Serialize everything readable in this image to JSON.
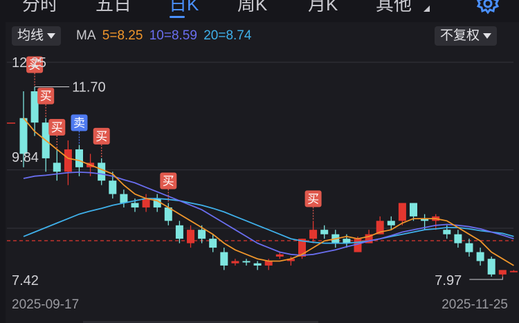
{
  "tabs": [
    {
      "label": "分时",
      "active": false
    },
    {
      "label": "五日",
      "active": false
    },
    {
      "label": "日K",
      "active": true
    },
    {
      "label": "周K",
      "active": false
    },
    {
      "label": "月K",
      "active": false
    },
    {
      "label": "其他",
      "active": false
    }
  ],
  "toolbar": {
    "ma_type": "均线",
    "adjust": "不复权",
    "settings_icon": "gear-icon"
  },
  "ma_legend": {
    "prefix": "MA",
    "ma5": "5=8.25",
    "ma10": "10=8.59",
    "ma20": "20=8.74"
  },
  "colors": {
    "up": "#e2362f",
    "down": "#7ee6e0",
    "ma5": "#f0962b",
    "ma10": "#6a6ef0",
    "ma20": "#3fb0ea",
    "accent": "#4a90ff",
    "buy": "#e0594d",
    "sell": "#4e7af0"
  },
  "chart_data": {
    "type": "candlestick",
    "y_range": [
      7.42,
      12.25
    ],
    "y_labels": [
      "12.25",
      "9.84",
      "7.42"
    ],
    "max_label": "11.70",
    "min_label": "7.97",
    "last_close": 7.97,
    "dates": {
      "start": "2025-09-17",
      "end": "2025-11-25"
    },
    "candles": [
      [
        11.0,
        10.2,
        11.6,
        9.9
      ],
      [
        11.6,
        10.9,
        11.7,
        10.6
      ],
      [
        10.9,
        10.1,
        11.0,
        9.8
      ],
      [
        10.0,
        9.8,
        10.3,
        9.6
      ],
      [
        9.8,
        10.3,
        10.5,
        9.5
      ],
      [
        10.3,
        9.9,
        10.4,
        9.7
      ],
      [
        9.9,
        10.0,
        10.2,
        9.7
      ],
      [
        10.0,
        9.6,
        10.1,
        9.5
      ],
      [
        9.6,
        9.3,
        9.8,
        9.2
      ],
      [
        9.3,
        9.1,
        9.4,
        9.0
      ],
      [
        9.1,
        9.0,
        9.2,
        8.9
      ],
      [
        9.0,
        9.2,
        9.3,
        8.9
      ],
      [
        9.2,
        9.0,
        9.3,
        8.9
      ],
      [
        9.0,
        8.7,
        9.1,
        8.6
      ],
      [
        8.6,
        8.3,
        8.7,
        8.2
      ],
      [
        8.2,
        8.5,
        8.6,
        8.1
      ],
      [
        8.5,
        8.3,
        8.6,
        8.2
      ],
      [
        8.3,
        8.1,
        8.4,
        8.0
      ],
      [
        8.0,
        7.7,
        8.1,
        7.6
      ],
      [
        7.75,
        7.8,
        7.85,
        7.7
      ],
      [
        7.8,
        7.78,
        7.85,
        7.7
      ],
      [
        7.75,
        7.7,
        7.8,
        7.6
      ],
      [
        7.7,
        7.8,
        7.85,
        7.6
      ],
      [
        7.9,
        7.95,
        8.0,
        7.85
      ],
      [
        7.8,
        7.85,
        7.9,
        7.7
      ],
      [
        7.9,
        8.3,
        8.3,
        7.85
      ],
      [
        8.3,
        8.5,
        8.7,
        8.2
      ],
      [
        8.5,
        8.4,
        8.6,
        8.3
      ],
      [
        8.4,
        8.2,
        8.5,
        8.1
      ],
      [
        8.3,
        8.2,
        8.4,
        8.1
      ],
      [
        8.0,
        8.3,
        8.35,
        8.0
      ],
      [
        8.2,
        8.4,
        8.5,
        8.2
      ],
      [
        8.4,
        8.7,
        8.8,
        8.4
      ],
      [
        8.7,
        8.6,
        8.8,
        8.5
      ],
      [
        8.7,
        9.1,
        9.1,
        8.6
      ],
      [
        9.1,
        8.8,
        9.1,
        8.7
      ],
      [
        8.75,
        8.7,
        8.85,
        8.5
      ],
      [
        8.7,
        8.8,
        8.85,
        8.5
      ],
      [
        8.5,
        8.4,
        8.6,
        8.3
      ],
      [
        8.4,
        8.2,
        8.5,
        8.1
      ],
      [
        8.2,
        8.0,
        8.3,
        7.9
      ],
      [
        8.0,
        7.8,
        8.1,
        7.7
      ],
      [
        7.85,
        7.5,
        7.9,
        7.45
      ],
      [
        7.5,
        7.6,
        7.55,
        7.45
      ],
      [
        7.58,
        7.58,
        7.6,
        7.55
      ]
    ],
    "ma5": [
      11.0,
      10.7,
      10.5,
      10.3,
      10.1,
      10.05,
      9.95,
      9.85,
      9.75,
      9.5,
      9.3,
      9.2,
      9.15,
      9.0,
      8.85,
      8.7,
      8.55,
      8.4,
      8.2,
      8.05,
      7.95,
      7.85,
      7.8,
      7.8,
      7.85,
      7.95,
      8.1,
      8.25,
      8.3,
      8.35,
      8.3,
      8.35,
      8.45,
      8.5,
      8.65,
      8.75,
      8.75,
      8.75,
      8.7,
      8.55,
      8.4,
      8.25,
      8.0,
      7.85,
      7.7
    ],
    "ma10": [
      9.65,
      9.7,
      9.72,
      9.75,
      9.78,
      9.79,
      9.78,
      9.75,
      9.7,
      9.62,
      9.55,
      9.45,
      9.35,
      9.25,
      9.15,
      9.05,
      8.95,
      8.8,
      8.65,
      8.5,
      8.35,
      8.2,
      8.1,
      8.0,
      7.95,
      7.93,
      7.95,
      8.0,
      8.05,
      8.12,
      8.18,
      8.25,
      8.3,
      8.37,
      8.45,
      8.5,
      8.55,
      8.6,
      8.62,
      8.6,
      8.57,
      8.52,
      8.45,
      8.38,
      8.3
    ],
    "ma20": [
      8.35,
      8.45,
      8.55,
      8.65,
      8.75,
      8.85,
      8.92,
      8.98,
      9.05,
      9.1,
      9.15,
      9.2,
      9.2,
      9.18,
      9.15,
      9.1,
      9.05,
      8.98,
      8.9,
      8.8,
      8.7,
      8.6,
      8.5,
      8.4,
      8.3,
      8.25,
      8.22,
      8.2,
      8.2,
      8.2,
      8.22,
      8.25,
      8.3,
      8.35,
      8.4,
      8.45,
      8.5,
      8.52,
      8.55,
      8.55,
      8.52,
      8.48,
      8.45,
      8.42,
      8.35
    ],
    "signals": [
      {
        "label": "买",
        "index": 1,
        "type": "buy"
      },
      {
        "label": "买",
        "index": 2,
        "type": "buy"
      },
      {
        "label": "买",
        "index": 3,
        "type": "buy"
      },
      {
        "label": "卖",
        "index": 5,
        "type": "sell"
      },
      {
        "label": "买",
        "index": 7,
        "type": "buy"
      },
      {
        "label": "买",
        "index": 13,
        "type": "buy"
      },
      {
        "label": "买",
        "index": 26,
        "type": "buy"
      }
    ]
  }
}
